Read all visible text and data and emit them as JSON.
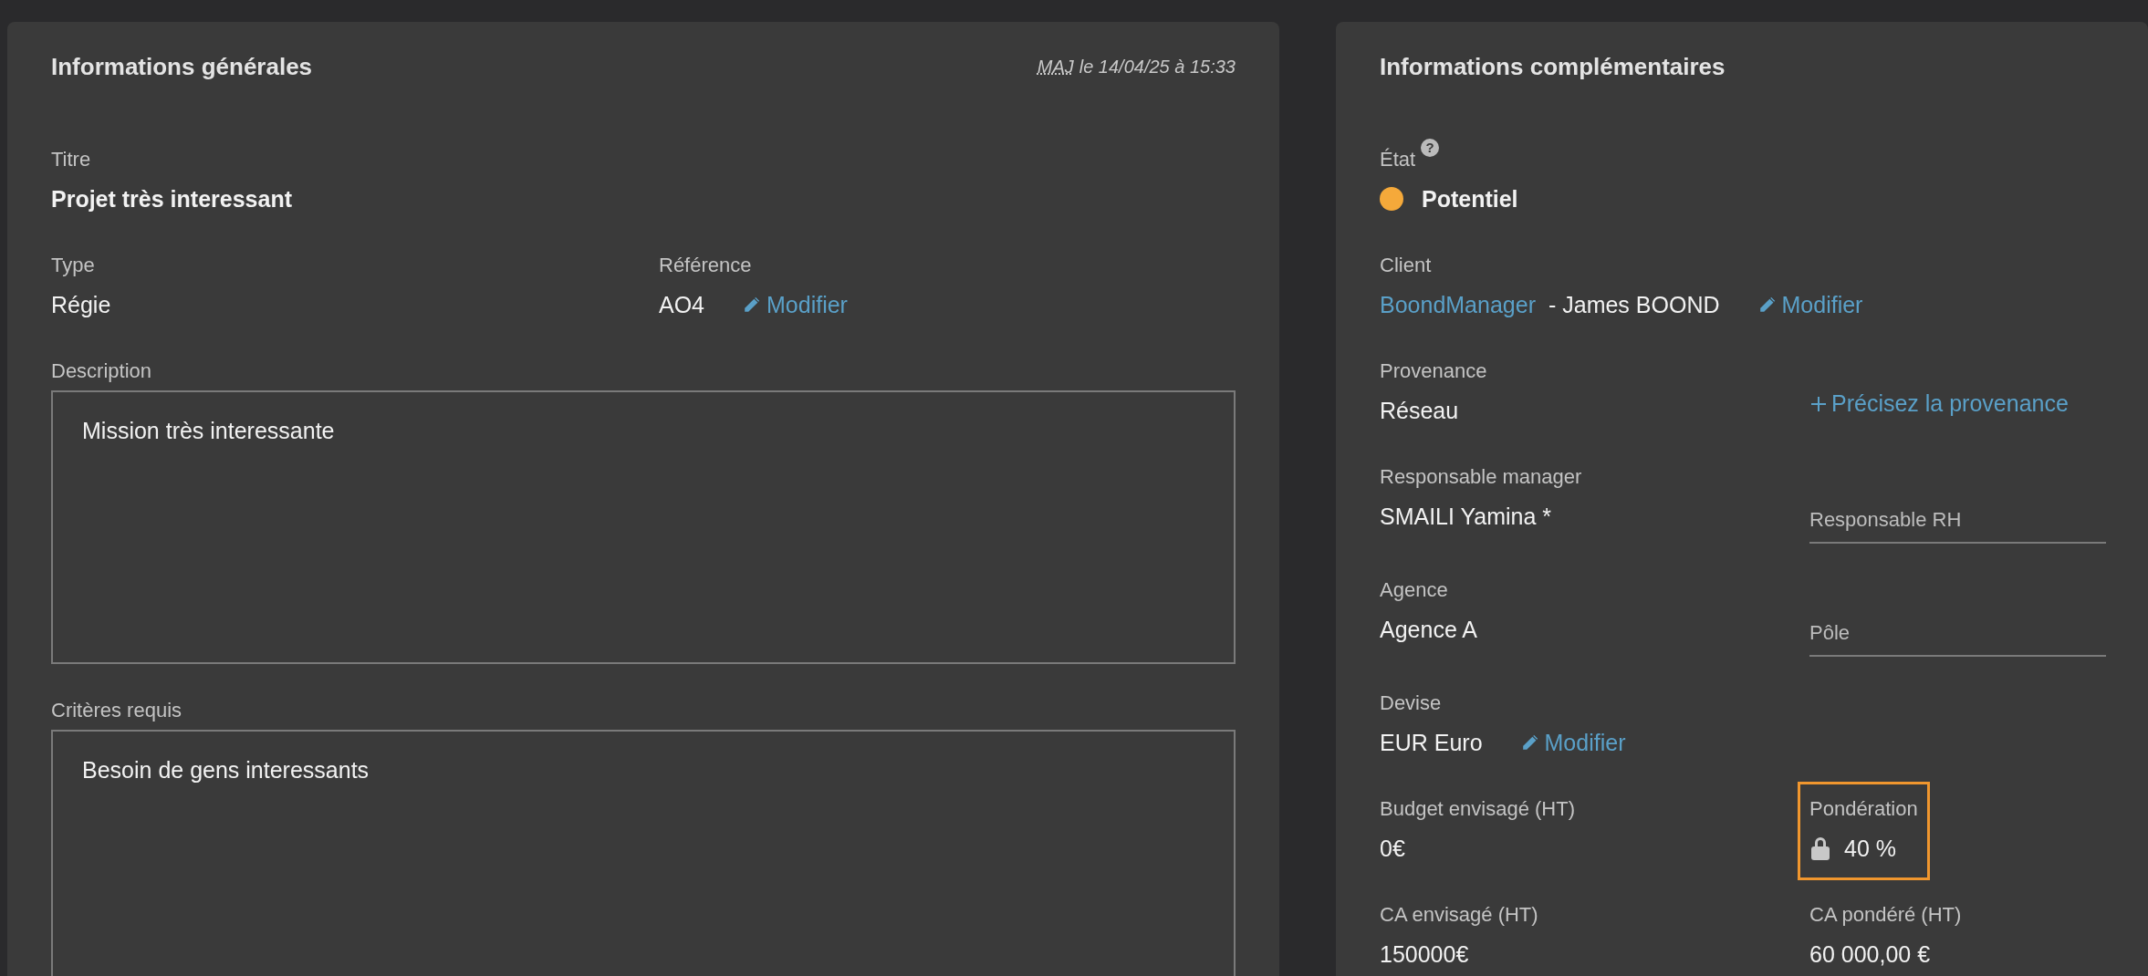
{
  "general": {
    "title": "Informations générales",
    "updated": {
      "abbr": "MAJ",
      "text": "le 14/04/25 à 15:33"
    },
    "rows": [
      [
        {
          "kind": "text",
          "label": "Titre",
          "value": "Projet très interessant",
          "bold": true
        }
      ],
      [
        {
          "kind": "text",
          "label": "Type",
          "value": "Régie"
        },
        {
          "kind": "text",
          "label": "Référence",
          "value": "AO4",
          "link": {
            "text": "Modifier"
          }
        }
      ],
      [
        {
          "kind": "textarea",
          "label": "Description",
          "value": "Mission très interessante"
        }
      ],
      [
        {
          "kind": "textarea",
          "label": "Critères requis",
          "value": "Besoin de gens interessants"
        }
      ]
    ]
  },
  "complementary": {
    "title": "Informations complémentaires",
    "rows": [
      [
        {
          "kind": "text",
          "label": "État",
          "help": "?",
          "color": "#f5a93a",
          "value": "Potentiel",
          "bold": true
        }
      ],
      [
        {
          "kind": "text",
          "label": "Client",
          "value_link": "BoondManager",
          "value": "- James BOOND",
          "link": {
            "text": "Modifier"
          }
        }
      ],
      [
        {
          "kind": "text",
          "label": "Provenance",
          "value": "Réseau"
        },
        {
          "kind": "action",
          "link": {
            "text": "Précisez la provenance"
          }
        }
      ],
      [
        {
          "kind": "text",
          "label": "Responsable manager",
          "value": "SMAILI Yamina *"
        },
        {
          "kind": "field",
          "placeholder": "Responsable RH"
        }
      ],
      [
        {
          "kind": "text",
          "label": "Agence",
          "value": "Agence A"
        },
        {
          "kind": "field",
          "placeholder": "Pôle"
        }
      ],
      [
        {
          "kind": "text",
          "label": "Devise",
          "value": "EUR Euro",
          "link": {
            "text": "Modifier"
          }
        }
      ],
      [
        {
          "kind": "text",
          "label": "Budget envisagé (HT)",
          "value": "0€"
        },
        {
          "kind": "text",
          "label": "Pondération",
          "value": "40 %",
          "locked": true,
          "highlighted": true
        }
      ],
      [
        {
          "kind": "text",
          "label": "CA envisagé (HT)",
          "value": "150000€"
        },
        {
          "kind": "text",
          "label": "CA pondéré (HT)",
          "value": "60 000,00 €"
        }
      ]
    ]
  }
}
